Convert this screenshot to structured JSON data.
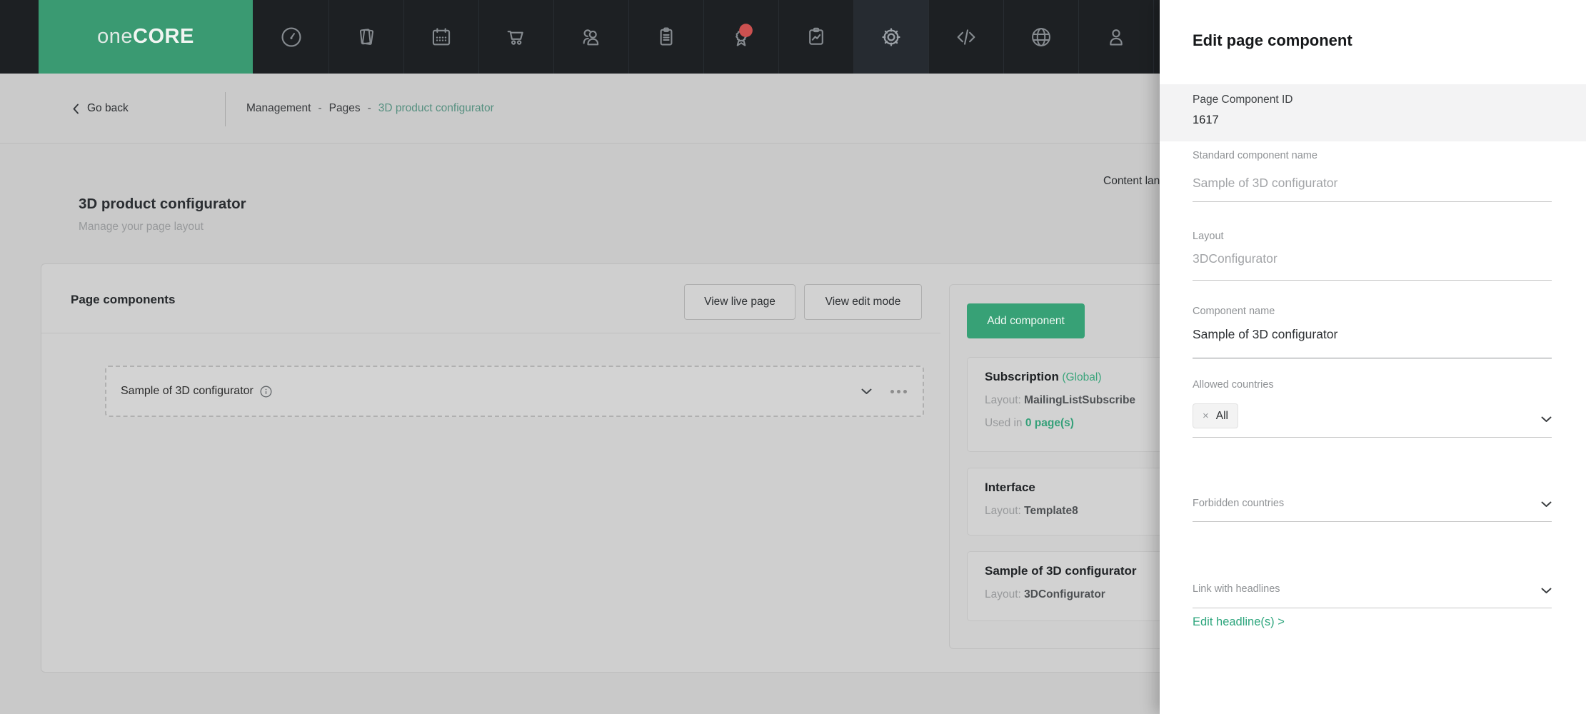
{
  "nav": {
    "logo": {
      "one": "one",
      "core": "CORE"
    },
    "icons": [
      "dashboard",
      "pages",
      "calendar",
      "cart",
      "users",
      "orders",
      "awards",
      "reports",
      "settings",
      "code",
      "globe",
      "account"
    ],
    "active_icon": "settings"
  },
  "breadcrumb": {
    "go_back": "Go back",
    "items": [
      "Management",
      "Pages",
      "3D product configurator"
    ],
    "separator": "-",
    "content_language_label": "Content lan"
  },
  "page": {
    "title": "3D product configurator",
    "subtitle": "Manage your page layout"
  },
  "components_card": {
    "title": "Page components",
    "view_live_button": "View live page",
    "view_edit_button": "View edit mode",
    "row": {
      "name": "Sample of 3D configurator"
    }
  },
  "right_column": {
    "add_button": "Add component",
    "cards": [
      {
        "title": "Subscription",
        "badge": "(Global)",
        "layout_label": "Layout:",
        "layout_value": "MailingListSubscribe",
        "used_label": "Used in",
        "used_value": "0 page(s)"
      },
      {
        "title": "Interface",
        "layout_label": "Layout:",
        "layout_value": "Template8"
      },
      {
        "title": "Sample of 3D configurator",
        "layout_label": "Layout:",
        "layout_value": "3DConfigurator"
      }
    ]
  },
  "panel": {
    "title": "Edit page component",
    "id_section": {
      "label": "Page Component ID",
      "value": "1617"
    },
    "fields": {
      "standard_name": {
        "label": "Standard component name",
        "value": "Sample of 3D configurator"
      },
      "layout": {
        "label": "Layout",
        "value": "3DConfigurator"
      },
      "component_name": {
        "label": "Component name",
        "value": "Sample of 3D configurator"
      },
      "allowed_countries": {
        "label": "Allowed countries",
        "chip": "All",
        "chip_remove": "×"
      },
      "forbidden_countries": {
        "label": "Forbidden countries"
      },
      "link_with_headlines": {
        "label": "Link with headlines"
      }
    },
    "edit_headlines_link": "Edit headline(s) >"
  },
  "colors": {
    "nav_bg": "#1d2023",
    "logo_green": "#3a9a72",
    "accent_green": "#37a176",
    "badge_green": "#3aa47b",
    "link_green": "#2ca57c",
    "notification_red": "#cc5150",
    "page_bg_dimmed": "#c9c9c9"
  }
}
